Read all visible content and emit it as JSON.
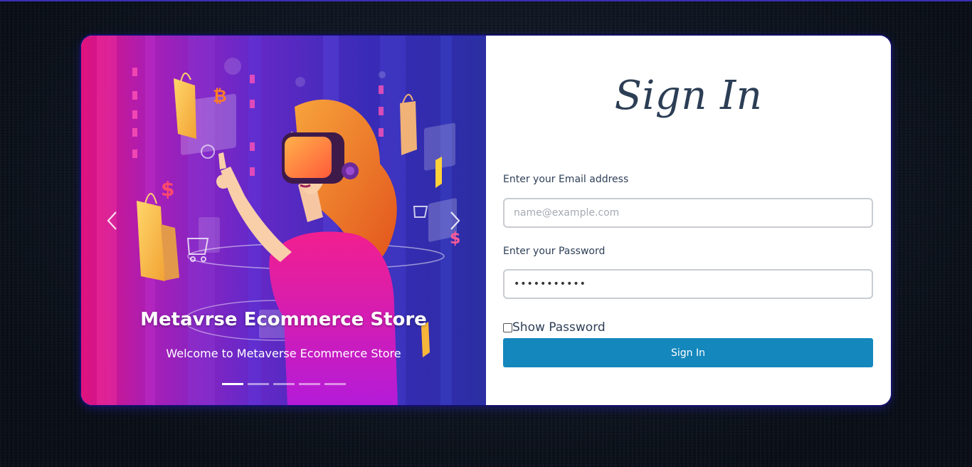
{
  "colors": {
    "accent": "#1487bd",
    "heading": "#2c3e55",
    "card_border": "#14106b"
  },
  "carousel": {
    "title": "Metavrse Ecommerce Store",
    "subtitle": "Welcome to Metaverse Ecommerce Store",
    "prev_icon": "chevron-left-icon",
    "next_icon": "chevron-right-icon",
    "slide_count": 5,
    "active_slide": 1
  },
  "form": {
    "heading": "Sign In",
    "email_label": "Enter your Email address",
    "email_placeholder": "name@example.com",
    "email_value": "",
    "password_label": "Enter your Password",
    "password_value": "•••••••••••",
    "show_password_label": "Show Password",
    "show_password_checked": false,
    "submit_label": "Sign In"
  }
}
